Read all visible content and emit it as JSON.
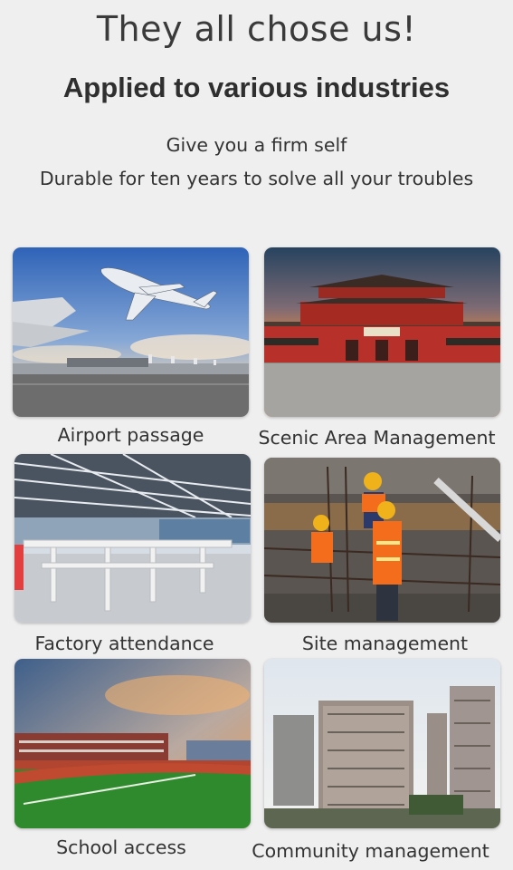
{
  "header": {
    "title": "They all chose us!",
    "subtitle": "Applied to various industries",
    "tagline_1": "Give you a firm self",
    "tagline_2": "Durable for ten years to solve all your troubles"
  },
  "cards": [
    {
      "label": "Airport passage"
    },
    {
      "label": "Scenic Area Management"
    },
    {
      "label": "Factory attendance"
    },
    {
      "label": "Site management"
    },
    {
      "label": "School access"
    },
    {
      "label": "Community management"
    }
  ]
}
